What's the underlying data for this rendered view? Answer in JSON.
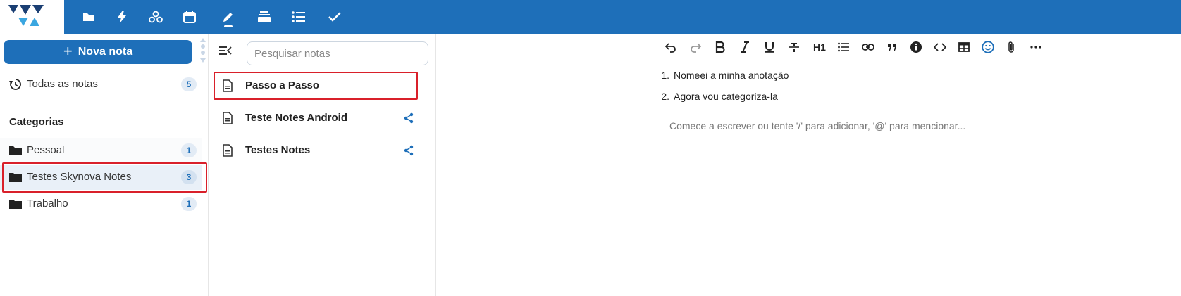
{
  "topbar": {
    "apps": [
      {
        "name": "files-app",
        "icon": "folder-icon"
      },
      {
        "name": "activity-app",
        "icon": "lightning-icon"
      },
      {
        "name": "circles-app",
        "icon": "circles-icon"
      },
      {
        "name": "calendar-app",
        "icon": "calendar-icon"
      },
      {
        "name": "notes-app",
        "icon": "pencil-icon"
      },
      {
        "name": "deck-app",
        "icon": "deck-icon"
      },
      {
        "name": "tasks-app",
        "icon": "list-icon"
      },
      {
        "name": "checklist-app",
        "icon": "check-icon"
      }
    ],
    "colors": {
      "bar": "#1e6fb9",
      "logo_dark": "#1b3f73",
      "logo_light": "#3aa6e0"
    }
  },
  "sidebar": {
    "new_note_label": "Nova nota",
    "all_notes": {
      "label": "Todas as notas",
      "count": "5"
    },
    "categories_title": "Categorias",
    "categories": [
      {
        "label": "Pessoal",
        "count": "1"
      },
      {
        "label": "Testes Skynova Notes",
        "count": "3"
      },
      {
        "label": "Trabalho",
        "count": "1"
      }
    ]
  },
  "notes_list": {
    "search_placeholder": "Pesquisar notas",
    "notes": [
      {
        "title": "Passo a Passo",
        "shared": false
      },
      {
        "title": "Teste Notes Android",
        "shared": true
      },
      {
        "title": "Testes Notes",
        "shared": true
      }
    ]
  },
  "editor": {
    "toolbar": {
      "heading_label": "H1"
    },
    "list_items": [
      {
        "num": "1.",
        "text": "Nomeei a minha anotação"
      },
      {
        "num": "2.",
        "text": "Agora vou categoriza-la"
      }
    ],
    "placeholder": "Comece a escrever ou tente '/' para adicionar, '@' para mencionar..."
  },
  "colors": {
    "accent": "#1e6fb9",
    "highlight": "#d9202a",
    "badge_bg": "#e2ebf5",
    "selected_row": "#e9f0f8"
  }
}
